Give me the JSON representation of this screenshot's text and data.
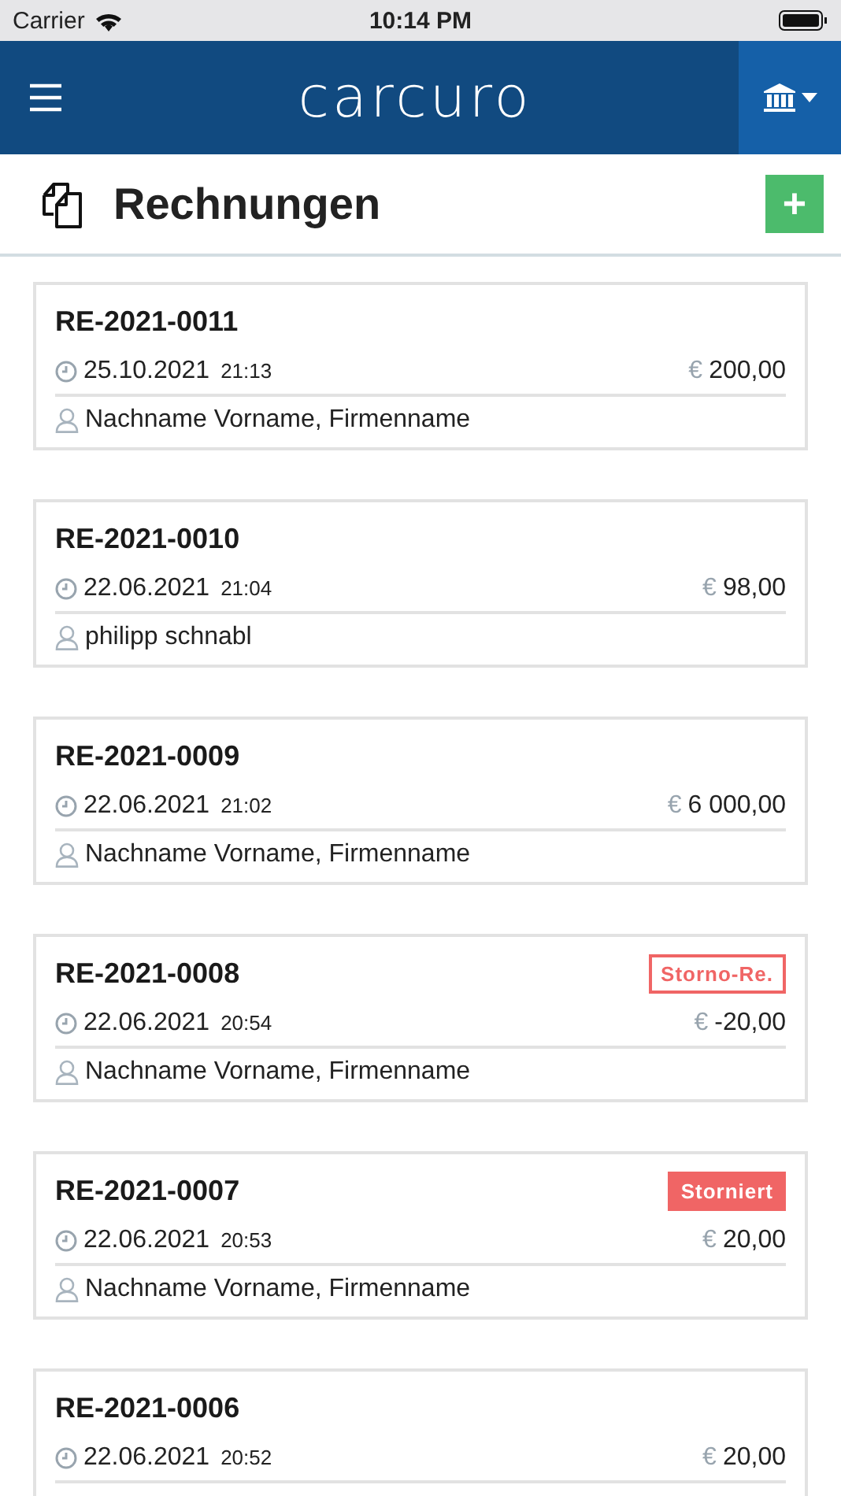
{
  "status_bar": {
    "carrier": "Carrier",
    "time": "10:14 PM"
  },
  "nav": {
    "logo": "carcuro"
  },
  "header": {
    "title": "Rechnungen",
    "add_label": "+"
  },
  "invoices": [
    {
      "number": "RE-2021-0011",
      "date": "25.10.2021",
      "time": "21:13",
      "currency": "€",
      "amount": "200,00",
      "customer": "Nachname Vorname, Firmenname"
    },
    {
      "number": "RE-2021-0010",
      "date": "22.06.2021",
      "time": "21:04",
      "currency": "€",
      "amount": "98,00",
      "customer": "philipp schnabl"
    },
    {
      "number": "RE-2021-0009",
      "date": "22.06.2021",
      "time": "21:02",
      "currency": "€",
      "amount": "6 000,00",
      "customer": "Nachname Vorname, Firmenname"
    },
    {
      "number": "RE-2021-0008",
      "badge": {
        "kind": "outline",
        "label": "Storno-Re."
      },
      "date": "22.06.2021",
      "time": "20:54",
      "currency": "€",
      "amount": "-20,00",
      "customer": "Nachname Vorname, Firmenname"
    },
    {
      "number": "RE-2021-0007",
      "badge": {
        "kind": "solid",
        "label": "Storniert"
      },
      "date": "22.06.2021",
      "time": "20:53",
      "currency": "€",
      "amount": "20,00",
      "customer": "Nachname Vorname, Firmenname"
    },
    {
      "number": "RE-2021-0006",
      "date": "22.06.2021",
      "time": "20:52",
      "currency": "€",
      "amount": "20,00"
    }
  ]
}
